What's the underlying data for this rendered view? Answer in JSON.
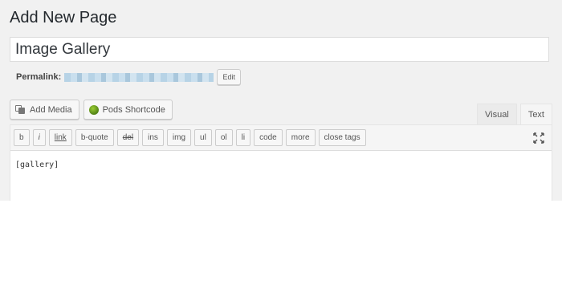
{
  "page": {
    "heading": "Add New Page"
  },
  "title_field": {
    "value": "Image Gallery"
  },
  "permalink": {
    "label": "Permalink:",
    "edit_label": "Edit"
  },
  "media_buttons": {
    "add_media": "Add Media",
    "pods_shortcode": "Pods Shortcode"
  },
  "editor_tabs": {
    "visual": "Visual",
    "text": "Text",
    "active": "Text"
  },
  "quicktags": [
    "b",
    "i",
    "link",
    "b-quote",
    "del",
    "ins",
    "img",
    "ul",
    "ol",
    "li",
    "code",
    "more",
    "close tags"
  ],
  "editor": {
    "content": "[gallery]"
  },
  "icons": {
    "add_media": "add-media-icon",
    "pods": "pods-icon",
    "fullscreen": "fullscreen-icon"
  }
}
